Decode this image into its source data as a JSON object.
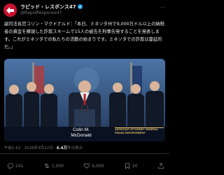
{
  "post": {
    "display_name": "ラピッド・レスポンス47",
    "handle": "@RapidResponse47",
    "more_label": "···",
    "text": "副司法長官コリン・マクドナルド：「本日、ミネソタ州で9,000万ドル以上の納税者の資金を横領した詐欺スキームで15人の被告を刑事告発することを発表します。これがミネソタでの私たちの活動の始まりです。ミネソタでの詐欺は蔓延的だ。」",
    "video": {
      "name_caption": "Colin M.\nMcDonald",
      "title_caption": "ASSISTANT ATTORNEY GENERAL\nFRAUD ENFORCEMENT"
    },
    "meta": {
      "time": "午前1:52 · 2026年3月22日",
      "views_count": "6.4万",
      "views_label": "件の表示"
    },
    "actions": {
      "replies": "241",
      "reposts": "1,000",
      "likes": "6,000",
      "bookmarks": "20"
    }
  },
  "colors": {
    "background": "#000000",
    "text_primary": "#e7e9ea",
    "text_secondary": "#71767b",
    "verified": "#1d9bf0",
    "avatar_bg": "#c8102e"
  }
}
